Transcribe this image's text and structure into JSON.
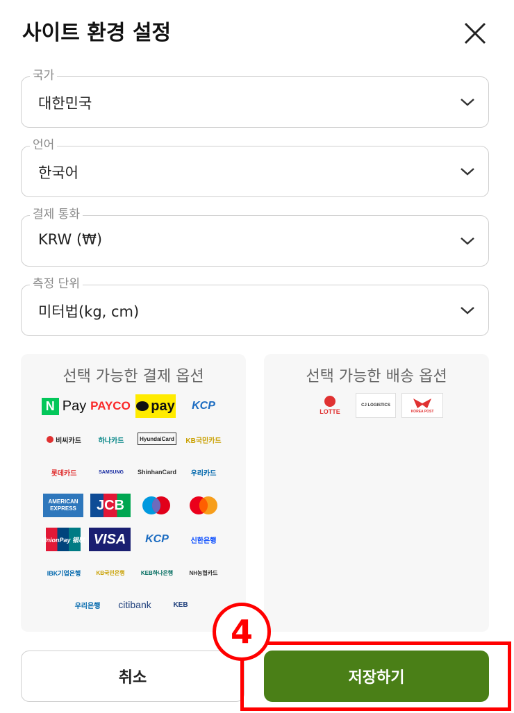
{
  "dialog": {
    "title": "사이트 환경 설정"
  },
  "fields": {
    "country": {
      "label": "국가",
      "value": "대한민국"
    },
    "language": {
      "label": "언어",
      "value": "한국어"
    },
    "currency": {
      "label": "결제 통화",
      "value": "KRW (₩)"
    },
    "units": {
      "label": "측정 단위",
      "value": "미터법(kg, cm)"
    }
  },
  "payment_panel": {
    "title": "선택 가능한 결제 옵션",
    "logos": {
      "npay_n": "N",
      "npay_text": "Pay",
      "payco": "PAYCO",
      "kakaopay": "pay",
      "kcp": "KCP",
      "bc": "비씨카드",
      "hana": "하나카드",
      "hyundai": "HyundaiCard",
      "kb": "KB국민카드",
      "lotte": "롯데카드",
      "samsung": "SAMSUNG",
      "shinhan": "ShinhanCard",
      "woori": "우리카드",
      "amex": "AMERICAN EXPRESS",
      "jcb": "JCB",
      "unionpay": "UnionPay 银联",
      "visa": "VISA",
      "kcp2": "KCP",
      "shinhan_bank": "신한은행",
      "ibk": "IBK기업은행",
      "kb_bank": "KB국민은행",
      "keb_hana": "KEB하나은행",
      "nh": "NH농협카드",
      "woori_bank": "우리은행",
      "citibank": "citibank",
      "keb": "KEB"
    }
  },
  "shipping_panel": {
    "title": "선택 가능한 배송 옵션",
    "logos": {
      "lotte": "LOTTE",
      "cj": "CJ LOGISTICS",
      "koreapost": "KOREA POST"
    }
  },
  "buttons": {
    "cancel": "취소",
    "save": "저장하기"
  },
  "annotation": {
    "step": "4"
  },
  "colors": {
    "save_bg": "#4a7f17",
    "highlight": "#ff0000",
    "border": "#cfcfcf"
  }
}
